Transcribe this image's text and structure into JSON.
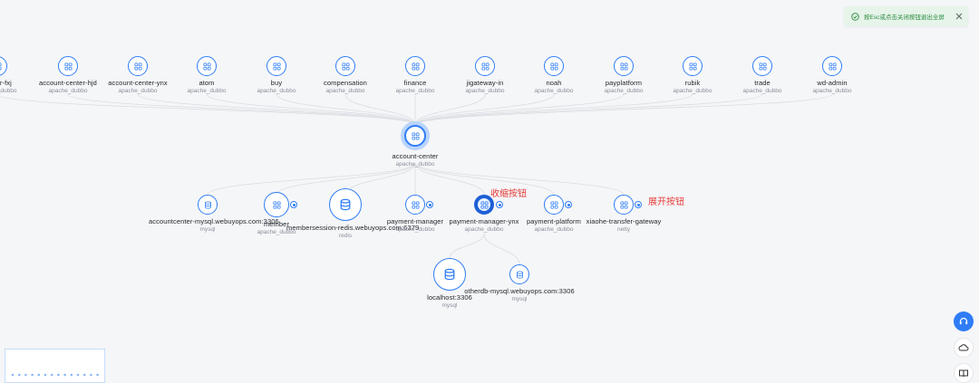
{
  "toast": {
    "message": "按Esc或点击关闭按钮退出全屏"
  },
  "upstream": [
    {
      "name": "center-fxj",
      "type": "apache_dubbo"
    },
    {
      "name": "account-center-hjd",
      "type": "apache_dubbo"
    },
    {
      "name": "account-center-ynx",
      "type": "apache_dubbo"
    },
    {
      "name": "atom",
      "type": "apache_dubbo"
    },
    {
      "name": "buy",
      "type": "apache_dubbo"
    },
    {
      "name": "compensation",
      "type": "apache_dubbo"
    },
    {
      "name": "finance",
      "type": "apache_dubbo"
    },
    {
      "name": "jigateway-in",
      "type": "apache_dubbo"
    },
    {
      "name": "noah",
      "type": "apache_dubbo"
    },
    {
      "name": "payplatform",
      "type": "apache_dubbo"
    },
    {
      "name": "rubik",
      "type": "apache_dubbo"
    },
    {
      "name": "trade",
      "type": "apache_dubbo"
    },
    {
      "name": "wd-admin",
      "type": "apache_dubbo"
    }
  ],
  "center": {
    "name": "account-center",
    "type": "apache_dubbo"
  },
  "downstream": [
    {
      "name": "accountcenter-mysql.webuyops.com:3306",
      "type": "mysql"
    },
    {
      "name": "member",
      "type": "apache_dubbo"
    },
    {
      "name": "membersession-redis.webuyops.com:6379",
      "type": "redis"
    },
    {
      "name": "payment-manager",
      "type": "apache_dubbo"
    },
    {
      "name": "payment-manager-ynx",
      "type": "apache_dubbo"
    },
    {
      "name": "payment-platform",
      "type": "apache_dubbo"
    },
    {
      "name": "xiaohe-transfer-gateway",
      "type": "netty"
    }
  ],
  "third": [
    {
      "name": "localhost:3306",
      "type": "mysql"
    },
    {
      "name": "otherdb-mysql.webuyops.com:3306",
      "type": "mysql"
    }
  ],
  "annotations": {
    "collapse": "收缩按钮",
    "expand": "展开按钮"
  },
  "colors": {
    "accent": "#2f7df6",
    "success": "#2c8a3e",
    "annotation": "#e53935"
  }
}
